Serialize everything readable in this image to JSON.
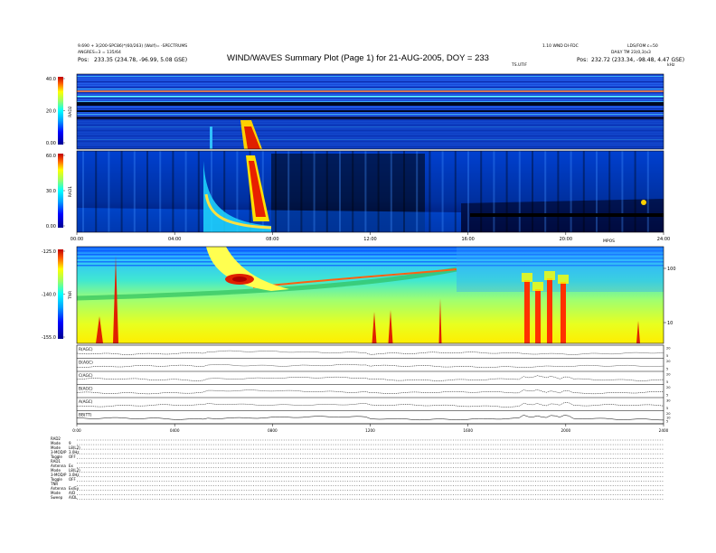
{
  "header": {
    "title": "WIND/WAVES Summary Plot (Page 1) for 21-AUG-2005, DOY = 233",
    "left_line1": "9.690 + 3(200-SPC86)*(60/263) (Wolf)= -SPECTRUMS",
    "left_line2": "ANGRES=3 = 135/64",
    "left_pos_label": "Pos:",
    "left_pos_value": "233.35 (234.78, -96.99, 5.08 GSE)",
    "right_line1": "1.10 WND DI-FDC",
    "right_line1b": "LDS/FOM c=50",
    "right_line2": "DAILY TM 23(0,3)x3",
    "right_pos_label": "Pos:",
    "right_pos_value": "232.72 (233.34, -98.48, 4.47 GSE)",
    "panel1_right_label": "TS.UTIF",
    "panel3_right_label": "MPOS",
    "corner_label": "kHz"
  },
  "chart_data": [
    {
      "type": "heatmap",
      "panel": "RAD2",
      "ylabel": "RAD2",
      "yticks": [
        40.0,
        20.0,
        0.0
      ],
      "ytick_labels": [
        "40.0",
        "20.0",
        "0.00"
      ],
      "colorscale": "jet"
    },
    {
      "type": "heatmap",
      "panel": "RAD1",
      "ylabel": "RAD1",
      "yticks": [
        50.0,
        30.0,
        0.0
      ],
      "ytick_labels": [
        "60.0",
        "30.0",
        "0.00"
      ],
      "colorscale": "jet",
      "xtick_labels": [
        "00:00",
        "04:00",
        "08:00",
        "12:00",
        "16:00",
        "20:00",
        "24:00"
      ]
    },
    {
      "type": "heatmap",
      "panel": "TNR",
      "ylabel": "TNR",
      "yticks": [
        -125.0,
        -140.0,
        -155.0
      ],
      "ytick_labels": [
        "-125.0",
        "-140.0",
        "-155.0"
      ],
      "right_ytick_labels": [
        "100",
        "10"
      ],
      "colorscale": "jet"
    },
    {
      "type": "line",
      "panel": "AGC",
      "series": [
        {
          "name": "R(AGC)",
          "right_ticks": [
            "20",
            "5"
          ]
        },
        {
          "name": "D(AGC)",
          "right_ticks": [
            "20",
            "5"
          ]
        },
        {
          "name": "C(AGC)",
          "right_ticks": [
            "20",
            "5"
          ]
        },
        {
          "name": "B(AGC)",
          "right_ticks": [
            "20",
            "5"
          ]
        },
        {
          "name": "A(AGC)",
          "right_ticks": [
            "30",
            "5"
          ]
        },
        {
          "name": "BB(TT)",
          "right_ticks": [
            "20",
            "10",
            "5"
          ]
        }
      ],
      "xtick_labels": [
        "0:00",
        "0400",
        "0800",
        "1200",
        "1600",
        "2000",
        "2400"
      ]
    }
  ],
  "footer_table": [
    {
      "k": "RAD2",
      "v": ""
    },
    {
      "k": "Mode",
      "v": "9"
    },
    {
      "k": "Mode",
      "v": "L8(L2)"
    },
    {
      "k": "3-MOD/P",
      "v": "3.0Hz"
    },
    {
      "k": "Toggle",
      "v": "OFF"
    },
    {
      "k": "RAD1",
      "v": ""
    },
    {
      "k": "Antenna",
      "v": "Ex"
    },
    {
      "k": "Mode",
      "v": "L8(L2)"
    },
    {
      "k": "3-MOD/P",
      "v": "3.0Hz"
    },
    {
      "k": "Toggle",
      "v": "OFF"
    },
    {
      "k": "TNR",
      "v": ""
    },
    {
      "k": "Antenna",
      "v": "Ex/Ey"
    },
    {
      "k": "Mode",
      "v": "A/D"
    },
    {
      "k": "Sweep",
      "v": "A/DL"
    }
  ]
}
